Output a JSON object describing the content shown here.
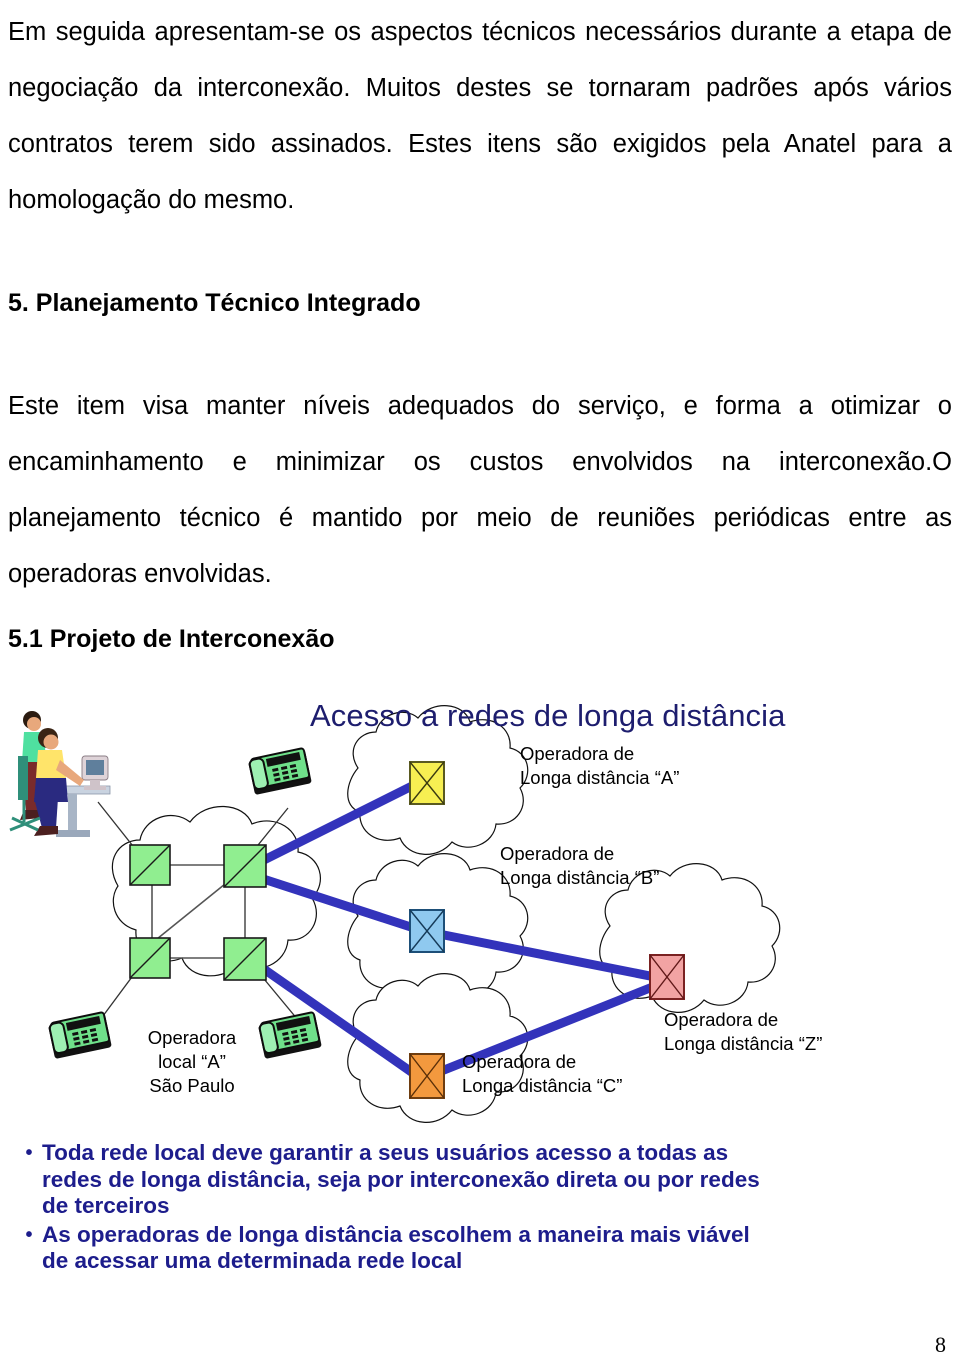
{
  "document": {
    "paragraphs": [
      "Em seguida apresentam-se os aspectos técnicos necessários durante a etapa de negociação da interconexão. Muitos destes se tornaram padrões após vários contratos terem sido assinados. Estes itens são exigidos pela Anatel para a homologação do mesmo.",
      "Este item visa manter níveis adequados do serviço, e forma a otimizar o encaminhamento e minimizar os custos envolvidos na interconexão.O planejamento técnico é mantido por meio de reuniões periódicas entre as operadoras envolvidas."
    ],
    "heading_1": "5. Planejamento Técnico Integrado",
    "heading_2": "5.1 Projeto de Interconexão",
    "page_number": "8"
  },
  "diagram": {
    "title": "Acesso a redes de longa distância",
    "title_color": "#1d1d6e",
    "link_color": "#3333bb",
    "labels": {
      "ld_a_line1": "Operadora de",
      "ld_a_line2": "Longa distância “A”",
      "ld_b_line1": "Operadora de",
      "ld_b_line2": "Longa distância “B”",
      "ld_c_line1": "Operadora de",
      "ld_c_line2": "Longa distância “C”",
      "ld_z_line1": "Operadora de",
      "ld_z_line2": "Longa distância “Z”",
      "local_line1": "Operadora",
      "local_line2": "local “A”",
      "local_line3": "São Paulo"
    },
    "switch_colors": {
      "local": "#90ee90",
      "ld_a": "#f7ef52",
      "ld_b": "#8fc9ef",
      "ld_c": "#f3993e",
      "ld_z": "#f2a3a3"
    }
  },
  "bullets": [
    "Toda rede local deve garantir a seus usuários acesso a todas as redes de longa distância, seja por interconexão direta ou por redes de terceiros",
    "As operadoras de longa distância escolhem a maneira mais viável de acessar uma determinada rede local"
  ],
  "bullet_marker": "•"
}
